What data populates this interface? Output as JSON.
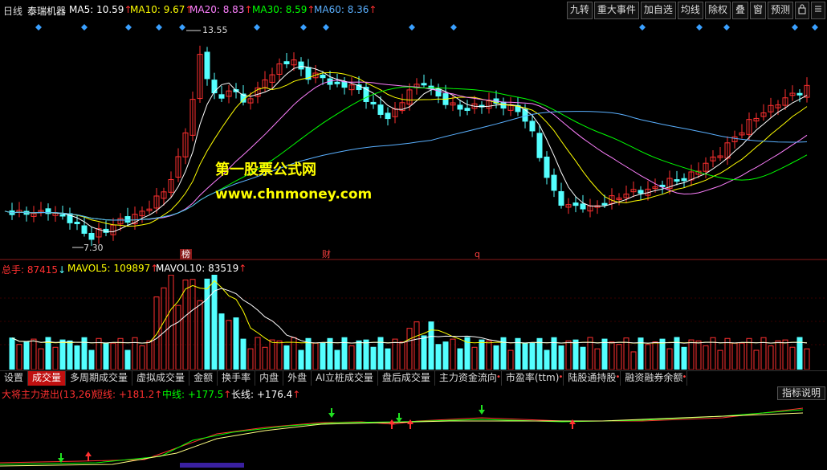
{
  "header": {
    "period": "日线",
    "stock": "泰瑞机器",
    "ma": [
      {
        "label": "MA5:",
        "value": "10.59",
        "arrow": "↑",
        "color": "#ffffff"
      },
      {
        "label": "MA10:",
        "value": "9.67",
        "arrow": "↑",
        "color": "#ffff00"
      },
      {
        "label": "MA20:",
        "value": "8.83",
        "arrow": "↑",
        "color": "#ff80ff"
      },
      {
        "label": "MA30:",
        "value": "8.59",
        "arrow": "↑",
        "color": "#00ff00"
      },
      {
        "label": "MA60:",
        "value": "8.36",
        "arrow": "↑",
        "color": "#5ab0ff"
      }
    ],
    "buttons": [
      "九转",
      "重大事件",
      "加自选",
      "均线",
      "除权",
      "叠",
      "窗",
      "预测"
    ],
    "icon_buttons": [
      "lock-icon",
      "menu-icon"
    ]
  },
  "main": {
    "high_label": "13.55",
    "low_label": "7.30",
    "tags": [
      "榜",
      "财",
      "q"
    ],
    "watermark_cn": "第一股票公式网",
    "watermark_url": "www.chnmoney.com"
  },
  "volume": {
    "label": "总手:",
    "value": "87415",
    "arrow": "↓",
    "mavol5_label": "MAVOL5:",
    "mavol5": "109897",
    "mavol5_arrow": "↑",
    "mavol10_label": "MAVOL10:",
    "mavol10": "83519",
    "mavol10_arrow": "↑"
  },
  "tabs": [
    {
      "label": "设置",
      "active": false,
      "dot": false
    },
    {
      "label": "成交量",
      "active": true,
      "dot": false
    },
    {
      "label": "多周期成交量",
      "active": false,
      "dot": false
    },
    {
      "label": "虚拟成交量",
      "active": false,
      "dot": false
    },
    {
      "label": "金额",
      "active": false,
      "dot": false
    },
    {
      "label": "换手率",
      "active": false,
      "dot": false
    },
    {
      "label": "内盘",
      "active": false,
      "dot": false
    },
    {
      "label": "外盘",
      "active": false,
      "dot": false
    },
    {
      "label": "AI立桩成交量",
      "active": false,
      "dot": false
    },
    {
      "label": "盘后成交量",
      "active": false,
      "dot": false
    },
    {
      "label": "主力资金流向",
      "active": false,
      "dot": true
    },
    {
      "label": "市盈率(ttm)",
      "active": false,
      "dot": true
    },
    {
      "label": "陆股通持股",
      "active": false,
      "dot": true
    },
    {
      "label": "融资融券余额",
      "active": false,
      "dot": true
    }
  ],
  "indicator": {
    "name": "大将主力进出(13,26)",
    "short_label": "短线:",
    "short": "+181.2",
    "short_arrow": "↑",
    "mid_label": "中线:",
    "mid": "+177.5",
    "mid_arrow": "↑",
    "long_label": "长线:",
    "long": "+176.4",
    "long_arrow": "↑",
    "help_button": "指标说明"
  },
  "colors": {
    "up": "#ff3030",
    "down": "#54ffff",
    "ma5": "#ffffff",
    "ma10": "#ffff00",
    "ma20": "#ff80ff",
    "ma30": "#00ff00",
    "ma60": "#5ab0ff"
  }
}
